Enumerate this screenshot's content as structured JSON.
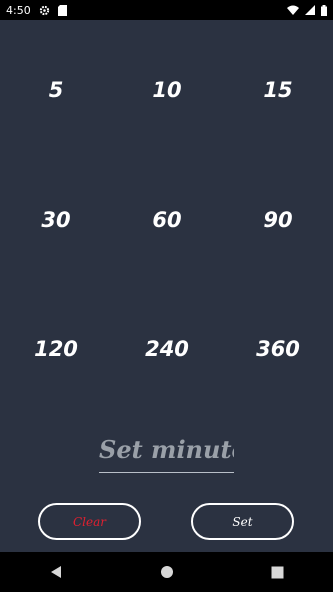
{
  "status_bar": {
    "time": "4:50",
    "icons": [
      "gear-icon",
      "sd-card-icon",
      "wifi-icon",
      "signal-icon",
      "battery-icon"
    ]
  },
  "minutes_grid": {
    "rows": [
      [
        "5",
        "10",
        "15"
      ],
      [
        "30",
        "60",
        "90"
      ],
      [
        "120",
        "240",
        "360"
      ]
    ]
  },
  "minutes_input": {
    "placeholder": "Set minutes",
    "value": ""
  },
  "buttons": {
    "clear_label": "Clear",
    "set_label": "Set"
  },
  "nav_bar": {
    "icons": [
      "back-icon",
      "home-icon",
      "recents-icon"
    ]
  },
  "colors": {
    "background": "#2b3241",
    "clear_text": "#e02030",
    "text": "#ffffff"
  }
}
